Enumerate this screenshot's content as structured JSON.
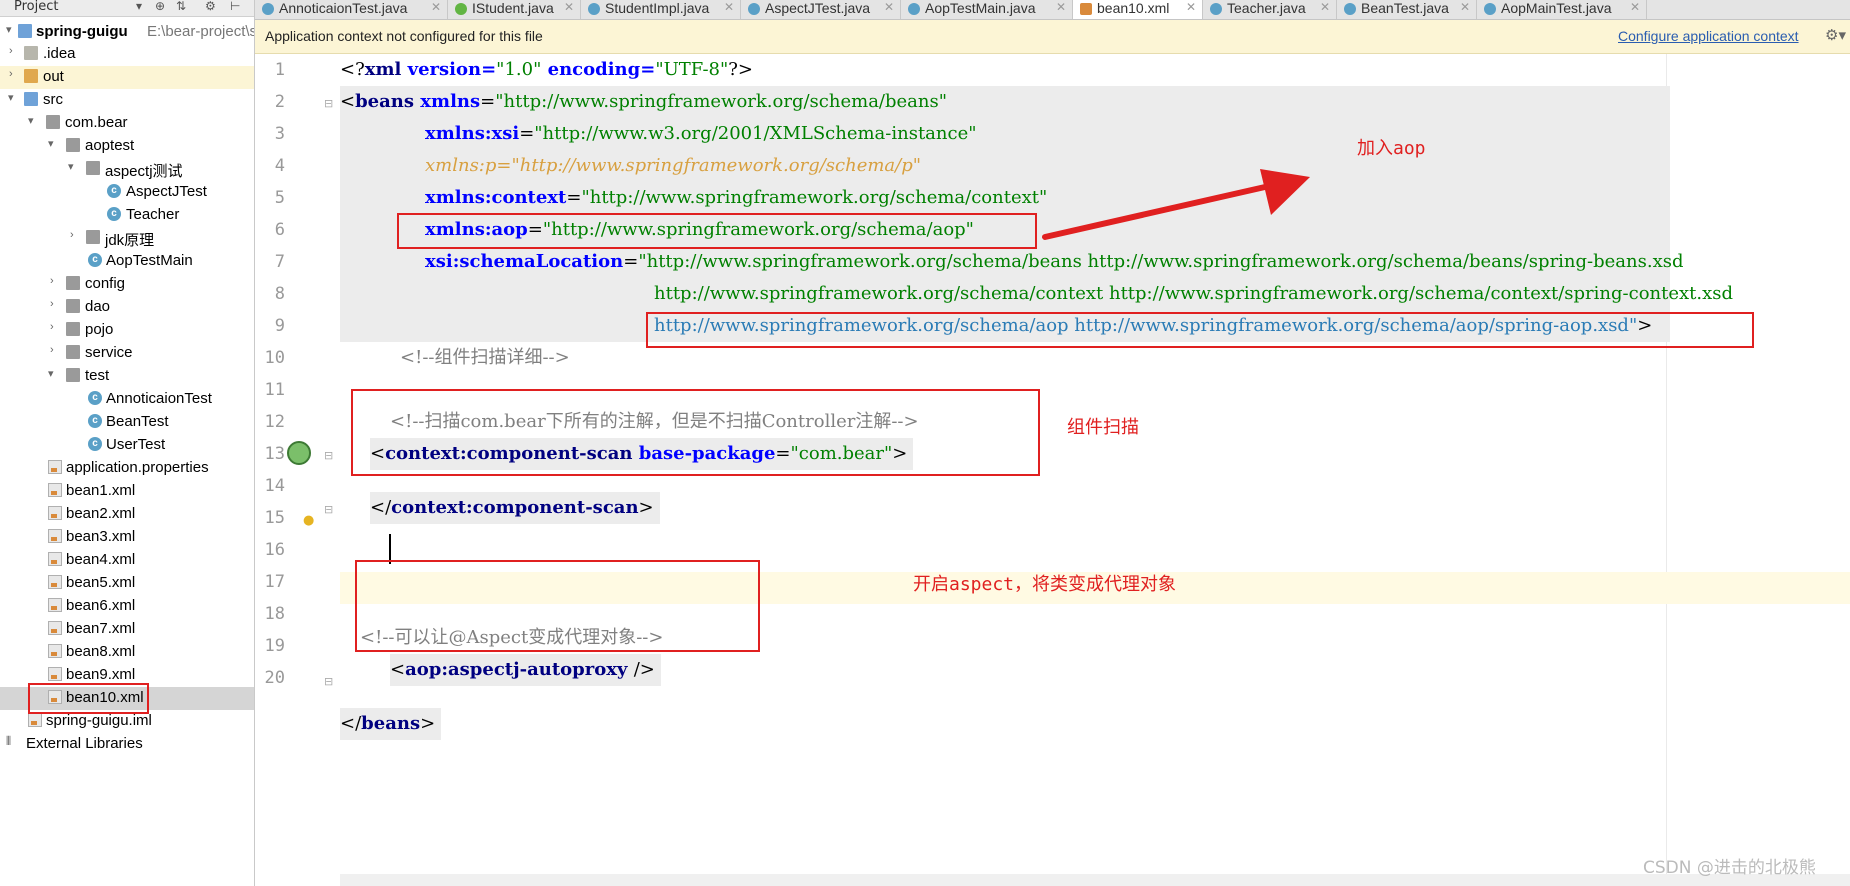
{
  "project_panel": {
    "title": "Project",
    "root": "spring-guigu",
    "root_path": "E:\\bear-project\\spri",
    "items": [
      {
        "label": ".idea"
      },
      {
        "label": "out"
      },
      {
        "label": "src"
      },
      {
        "label": "com.bear"
      },
      {
        "label": "aoptest"
      },
      {
        "label": "aspectj测试"
      },
      {
        "label": "AspectJTest"
      },
      {
        "label": "Teacher"
      },
      {
        "label": "jdk原理"
      },
      {
        "label": "AopTestMain"
      },
      {
        "label": "config"
      },
      {
        "label": "dao"
      },
      {
        "label": "pojo"
      },
      {
        "label": "service"
      },
      {
        "label": "test"
      },
      {
        "label": "AnnoticaionTest"
      },
      {
        "label": "BeanTest"
      },
      {
        "label": "UserTest"
      },
      {
        "label": "application.properties"
      },
      {
        "label": "bean1.xml"
      },
      {
        "label": "bean2.xml"
      },
      {
        "label": "bean3.xml"
      },
      {
        "label": "bean4.xml"
      },
      {
        "label": "bean5.xml"
      },
      {
        "label": "bean6.xml"
      },
      {
        "label": "bean7.xml"
      },
      {
        "label": "bean8.xml"
      },
      {
        "label": "bean9.xml"
      },
      {
        "label": "bean10.xml"
      },
      {
        "label": "spring-guigu.iml"
      },
      {
        "label": "External Libraries"
      }
    ]
  },
  "tabs": [
    {
      "label": "AnnoticaionTest.java"
    },
    {
      "label": "IStudent.java"
    },
    {
      "label": "StudentImpl.java"
    },
    {
      "label": "AspectJTest.java"
    },
    {
      "label": "AopTestMain.java"
    },
    {
      "label": "bean10.xml"
    },
    {
      "label": "Teacher.java"
    },
    {
      "label": "BeanTest.java"
    },
    {
      "label": "AopMainTest.java"
    }
  ],
  "banner": {
    "message": "Application context not configured for this file",
    "link": "Configure application context"
  },
  "line_numbers": [
    "1",
    "2",
    "3",
    "4",
    "5",
    "6",
    "7",
    "8",
    "9",
    "10",
    "11",
    "12",
    "13",
    "14",
    "15",
    "16",
    "17",
    "18",
    "19",
    "20"
  ],
  "code": {
    "l1": {
      "a": "<?",
      "b": "xml",
      "c": " version=",
      "d": "\"1.0\"",
      "e": " encoding=",
      "f": "\"UTF-8\"",
      "g": "?>"
    },
    "l2": {
      "a": "<",
      "b": "beans ",
      "c": "xmlns",
      "d": "=",
      "e": "\"http://www.springframework.org/schema/beans\""
    },
    "l3": {
      "a": "xmlns:xsi",
      "b": "=",
      "c": "\"http://www.w3.org/2001/XMLSchema-instance\""
    },
    "l4": {
      "a": "xmlns:p=\"http://www.springframework.org/schema/p\""
    },
    "l5": {
      "a": "xmlns:context",
      "b": "=",
      "c": "\"http://www.springframework.org/schema/context\""
    },
    "l6": {
      "a": "xmlns:aop",
      "b": "=",
      "c": "\"http://www.springframework.org/schema/aop\""
    },
    "l7": {
      "a": "xsi:schemaLocation",
      "b": "=",
      "c": "\"http://www.springframework.org/schema/beans http://www.springframework.org/schema/beans/spring-beans.xsd"
    },
    "l8": {
      "a": "http://www.springframework.org/schema/context http://www.springframework.org/schema/context/spring-context.xsd"
    },
    "l9": {
      "a": "http://www.springframework.org/schema/aop http://www.springframework.org/schema/aop/spring-aop.xsd\"",
      "b": ">"
    },
    "l10": {
      "a": "<!--组件扫描详细-->"
    },
    "l12": {
      "a": "<!--扫描com.bear下所有的注解，但是不扫描Controller注解-->"
    },
    "l13": {
      "a": "<",
      "b": "context:component-scan ",
      "c": "base-package",
      "d": "=",
      "e": "\"com.bear\"",
      "f": ">"
    },
    "l15": {
      "a": "</",
      "b": "context:component-scan",
      "c": ">"
    },
    "l17": {
      "a": "<!--可以让@Aspect变成代理对象-->"
    },
    "l18": {
      "a": "<",
      "b": "aop:aspectj-autoproxy ",
      "c": "/>"
    },
    "l20": {
      "a": "</",
      "b": "beans",
      "c": ">"
    }
  },
  "annotations": {
    "add_aop": "加入aop",
    "component_scan": "组件扫描",
    "enable_aspect": "开启aspect，将类变成代理对象"
  },
  "watermark": "CSDN @进击的北极熊"
}
